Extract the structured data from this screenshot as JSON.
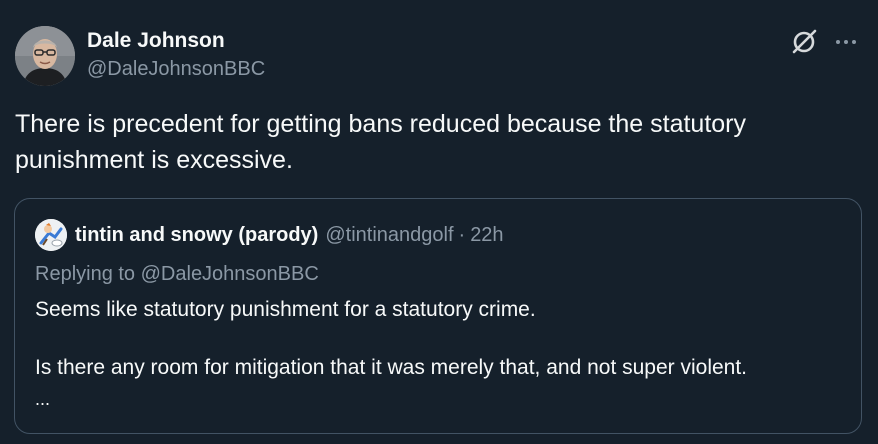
{
  "post": {
    "author": {
      "display_name": "Dale Johnson",
      "handle": "@DaleJohnsonBBC"
    },
    "text": "There is precedent for getting bans reduced because the statutory punishment is excessive.",
    "actions": {
      "grok_icon": "grok-icon",
      "more_icon": "more-horizontal-icon"
    }
  },
  "quoted_post": {
    "author": {
      "display_name": "tintin and snowy (parody)",
      "handle": "@tintinandgolf"
    },
    "separator": "·",
    "time": "22h",
    "replying_to_prefix": "Replying to",
    "replying_to_handle": "@DaleJohnsonBBC",
    "paragraphs": [
      "Seems like statutory punishment for a statutory crime.",
      "Is there any room for mitigation that it was merely that, and not super violent."
    ],
    "truncation": "..."
  },
  "colors": {
    "background": "#15202b",
    "primary_text": "#f7f9f9",
    "secondary_text": "#8b98a5",
    "border": "#425364"
  }
}
